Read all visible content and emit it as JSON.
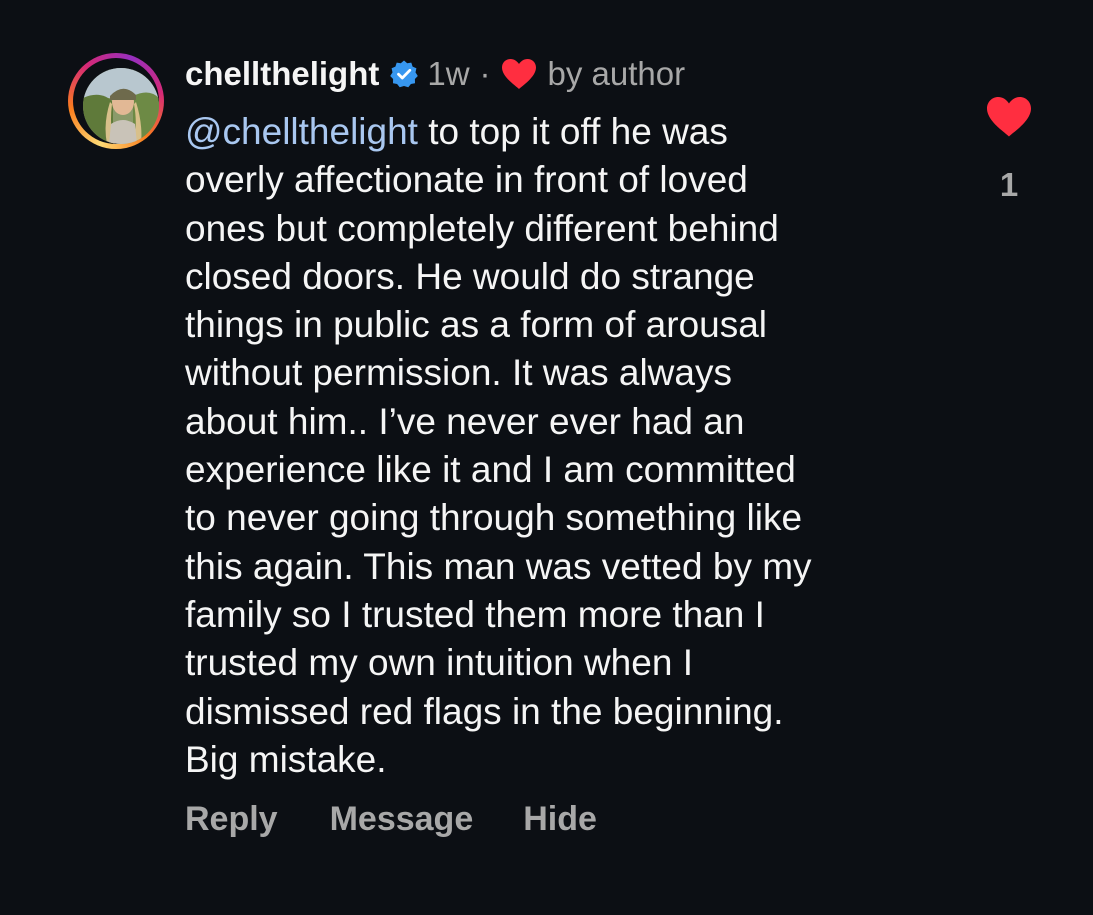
{
  "comment": {
    "username": "chellthelight",
    "verified_icon": "verified-badge-icon",
    "time": "1w",
    "separator": "·",
    "liked_by_author_icon": "heart-icon",
    "liked_by_label": "by author",
    "mention": "@chellthelight",
    "lines": [
      " to top it off he was",
      "overly affectionate in front of loved",
      "ones but completely different behind",
      "closed doors. He would do strange",
      "things in public as a form of arousal",
      "without permission. It was always",
      "about him.. I’ve never ever had an",
      "experience like it and I am committed",
      "to never going through something like",
      "this again. This man was vetted by my",
      "family so I trusted them more than I",
      "trusted my own intuition when I",
      "dismissed red flags in the beginning.",
      "Big mistake."
    ],
    "actions": {
      "reply": "Reply",
      "message": "Message",
      "hide": "Hide"
    },
    "like": {
      "icon": "heart-filled-icon",
      "count": "1"
    }
  },
  "colors": {
    "background": "#0c0f14",
    "text": "#f5f5f5",
    "secondary": "#a8a8a8",
    "mention": "#a9c7f0",
    "heart": "#ff2e40",
    "verified": "#3797f0"
  }
}
